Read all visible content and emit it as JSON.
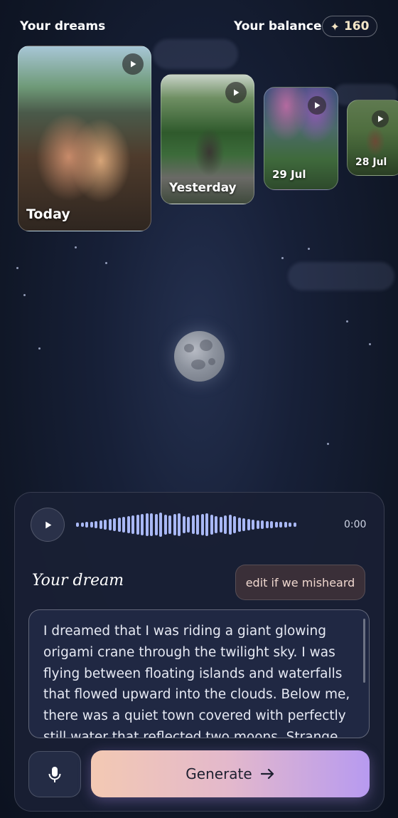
{
  "header": {
    "title": "Your dreams",
    "balance_label": "Your balance",
    "balance_value": "160",
    "balance_icon": "sparkle-icon"
  },
  "dreams": [
    {
      "label": "Today"
    },
    {
      "label": "Yesterday"
    },
    {
      "label": "29 Jul"
    },
    {
      "label": "28 Jul"
    }
  ],
  "audio": {
    "time": "0:00"
  },
  "dream": {
    "title": "Your dream",
    "edit_label": "edit if we misheard",
    "text": "I dreamed that I was riding a giant glowing origami crane through the twilight sky. I was flying between floating islands and waterfalls that flowed upward into the clouds. Below me, there was a quiet town covered with perfectly still water that reflected two moons. Strange"
  },
  "actions": {
    "generate_label": "Generate"
  },
  "colors": {
    "accent_start": "#f3c9b3",
    "accent_end": "#b79af0",
    "waveform": "#a9b8f5"
  }
}
